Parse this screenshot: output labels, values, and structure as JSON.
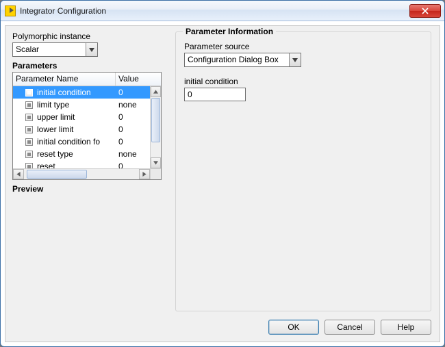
{
  "window": {
    "title": "Integrator Configuration"
  },
  "left": {
    "poly_label": "Polymorphic instance",
    "poly_value": "Scalar",
    "params_heading": "Parameters",
    "col_name": "Parameter Name",
    "col_value": "Value",
    "rows": [
      {
        "name": "initial condition",
        "value": "0",
        "selected": true
      },
      {
        "name": "limit type",
        "value": "none",
        "selected": false
      },
      {
        "name": "upper limit",
        "value": "0",
        "selected": false
      },
      {
        "name": "lower limit",
        "value": "0",
        "selected": false
      },
      {
        "name": "initial condition fo",
        "value": "0",
        "selected": false
      },
      {
        "name": "reset type",
        "value": "none",
        "selected": false
      },
      {
        "name": "reset",
        "value": "0",
        "selected": false
      }
    ],
    "preview_heading": "Preview"
  },
  "right": {
    "group_title": "Parameter Information",
    "source_label": "Parameter source",
    "source_value": "Configuration Dialog Box",
    "field_label": "initial condition",
    "field_value": "0"
  },
  "buttons": {
    "ok": "OK",
    "cancel": "Cancel",
    "help": "Help"
  }
}
